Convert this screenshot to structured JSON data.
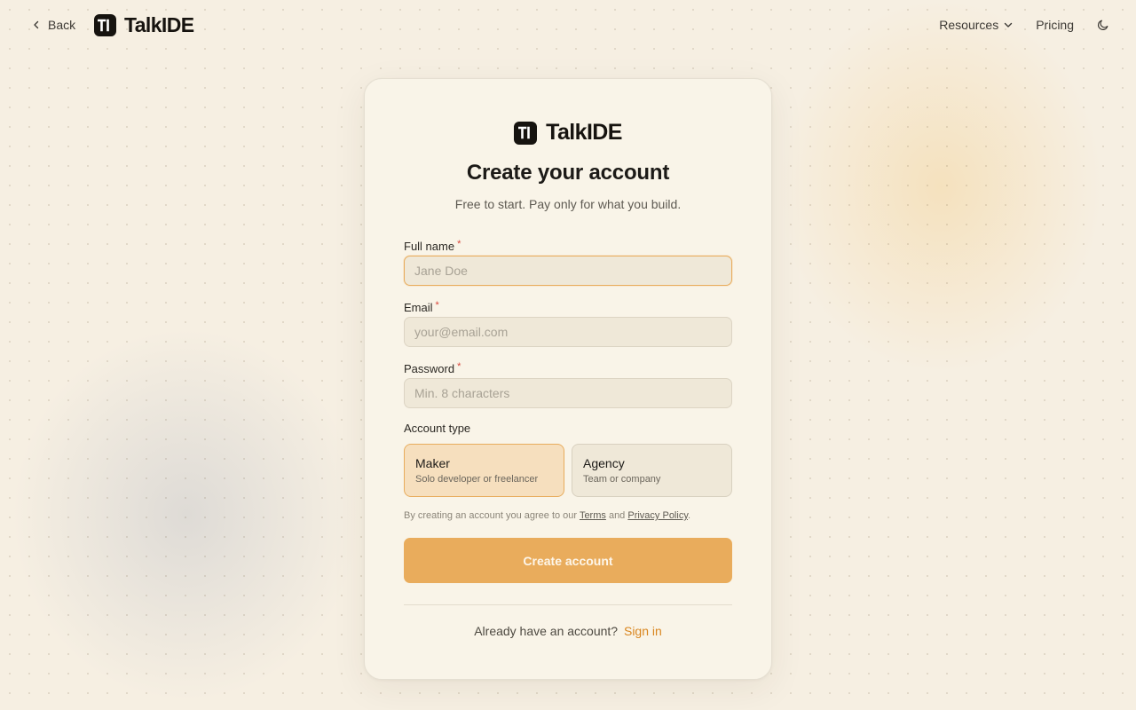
{
  "header": {
    "back_label": "Back",
    "brand_name": "TalkIDE",
    "nav": {
      "resources_label": "Resources",
      "pricing_label": "Pricing"
    },
    "theme_toggle_icon": "moon-icon"
  },
  "card": {
    "brand_name": "TalkIDE",
    "title": "Create your account",
    "subtitle": "Free to start. Pay only for what you build.",
    "fields": {
      "full_name": {
        "label": "Full name",
        "required_mark": "*",
        "placeholder": "Jane Doe",
        "value": ""
      },
      "email": {
        "label": "Email",
        "required_mark": "*",
        "placeholder": "your@email.com",
        "value": ""
      },
      "password": {
        "label": "Password",
        "required_mark": "*",
        "placeholder": "Min. 8 characters",
        "value": ""
      }
    },
    "account_type": {
      "label": "Account type",
      "selected": "Maker",
      "options": [
        {
          "title": "Maker",
          "description": "Solo developer or freelancer"
        },
        {
          "title": "Agency",
          "description": "Team or company"
        }
      ]
    },
    "terms": {
      "prefix": "By creating an account you agree to our ",
      "terms_link": "Terms",
      "middle": " and ",
      "privacy_link": "Privacy Policy",
      "suffix": "."
    },
    "submit_label": "Create account",
    "footer": {
      "prompt": "Already have an account?",
      "signin_label": "Sign in"
    }
  },
  "colors": {
    "accent": "#e9ac5c",
    "accent_text": "#d9861f",
    "background": "#f6efe2",
    "card_background": "#f9f4e8",
    "required": "#d8453a"
  }
}
